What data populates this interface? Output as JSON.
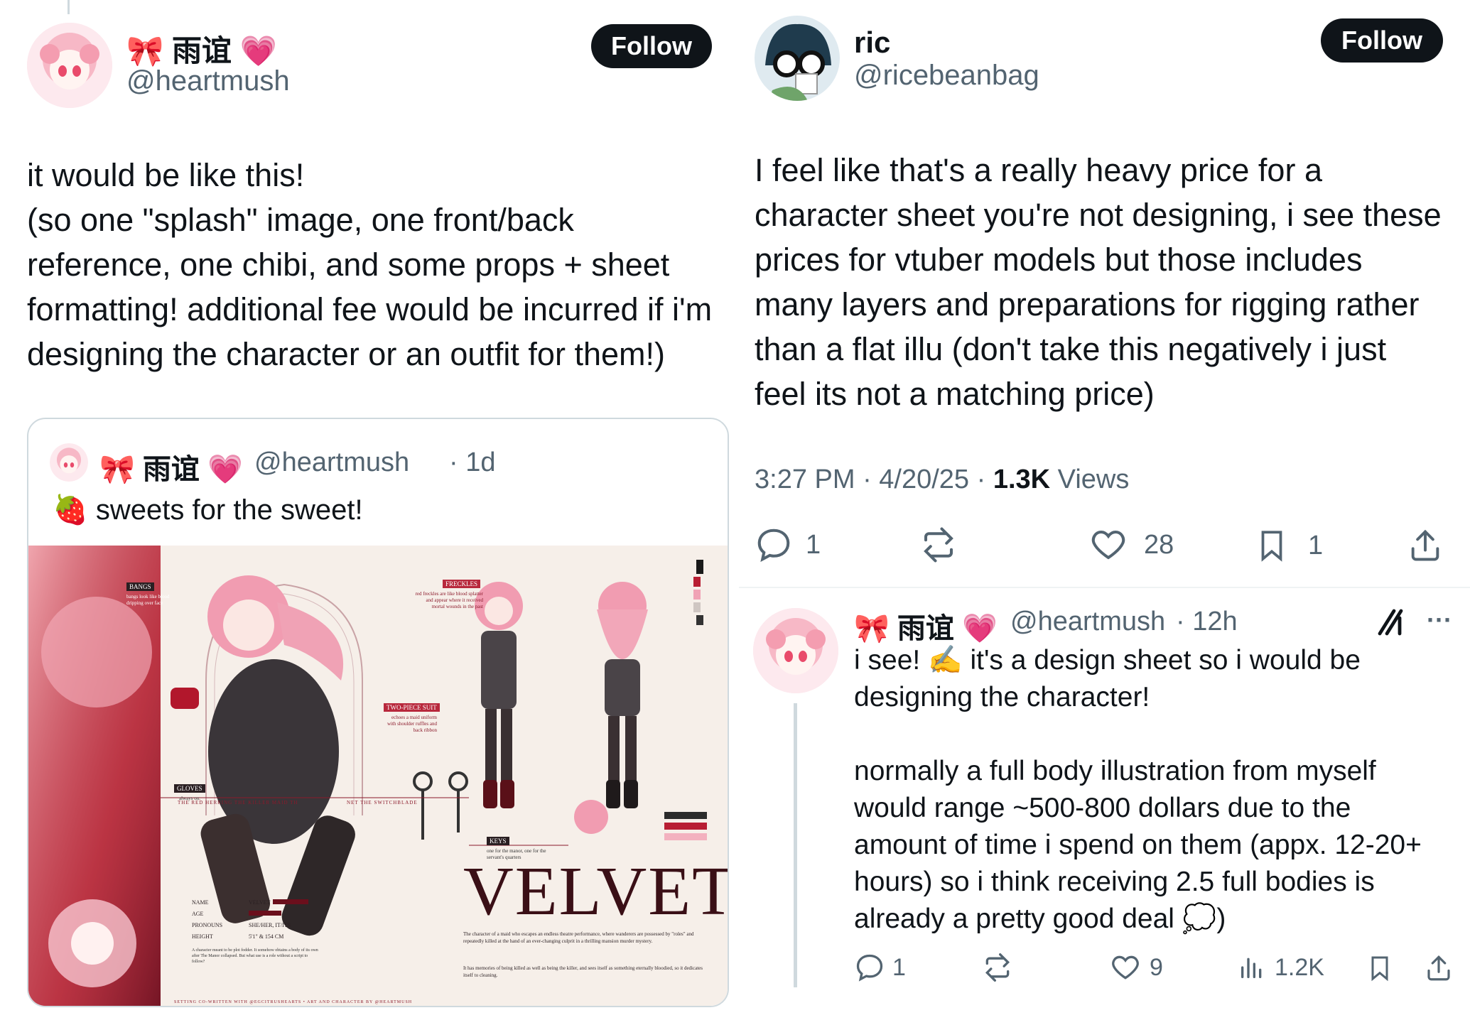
{
  "left_tweet": {
    "display_name": "🎀 雨谊 💗",
    "handle": "@heartmush",
    "follow_label": "Follow",
    "text": "it would be like this!\n(so one \"splash\" image, one front/back\nreference, one chibi, and some props + sheet\nformatting! additional fee would be incurred if i'm\ndesigning the character or an outfit for them!)",
    "quote": {
      "display_name": "🎀 雨谊 💗",
      "handle": "@heartmush",
      "time": "· 1d",
      "text": "🍓 sweets for the sweet!",
      "sheet": {
        "title": "VELVET",
        "labels": [
          "BANGS",
          "FRECKLES",
          "TWO-PIECE SUIT",
          "GLOVES",
          "KEYS"
        ],
        "notes": {
          "bangs": "bangs look like blood dripping over face",
          "freckles": "red freckles are like blood splatter and appear where it received mortal wounds in the past",
          "suit": "echoes a maid uniform with shoulder ruffles and back ribbon",
          "gloves": "always on.",
          "keys": "one for the manor, one for the servant's quarters"
        },
        "stats": [
          {
            "k": "NAME",
            "v": "VELVET"
          },
          {
            "k": "AGE",
            "v": ""
          },
          {
            "k": "PRONOUNS",
            "v": "SHE/HER, IT/ITS"
          },
          {
            "k": "HEIGHT",
            "v": "5'1\" & 154 CM"
          }
        ],
        "ribbon_left": "THE RED HERRING THE KILLER MAID TH",
        "ribbon_right": "NET THE SWITCHBLADE",
        "desc1": "The character of a maid who escapes an endless theatre performance, where wanderers are possessed by \"roles\" and repeatedly killed at the hand of an ever-changing culprit in a thrilling mansion murder mystery.",
        "desc2": "It has memories of being killed as well as being the killer, and sees itself as something eternally bloodied, so it dedicates itself to cleaning.",
        "small_note": "A character meant to be plot fodder. It somehow obtains a body of its own after The Manor collapsed. But what use is a role without a script to follow?",
        "footer": "SETTING CO-WRITTEN WITH @EGCITRUSHEARTS • ART AND CHARACTER BY @HEARTMUSH"
      }
    }
  },
  "right_tweet": {
    "display_name": "ric",
    "handle": "@ricebeanbag",
    "follow_label": "Follow",
    "text": "I feel like that's a really heavy price for a\ncharacter sheet you're not designing, i see these\nprices for vtuber models but those includes\nmany layers and preparations for rigging rather\nthan a flat illu  (don't take this negatively i just\nfeel its not a matching price)",
    "time": "3:27 PM · 4/20/25 · ",
    "views_count": "1.3K",
    "views_label": " Views",
    "stats": {
      "replies": "1",
      "reposts": "",
      "likes": "28",
      "bookmarks": "1"
    }
  },
  "reply_tweet": {
    "display_name": "🎀 雨谊 💗",
    "handle": "@heartmush",
    "time": "· 12h",
    "text": "i see! ✍️ it's a design sheet so i would be\ndesigning the character!\n\nnormally a full body illustration from myself\nwould range ~500-800 dollars due to the\namount of time i spend on them (appx. 12-20+\nhours) so i think receiving 2.5 full bodies is\nalready a pretty good deal 💭)",
    "more_label": "···",
    "stats": {
      "replies": "1",
      "reposts": "",
      "likes": "9",
      "views": "1.2K"
    }
  },
  "colors": {
    "accent": "#0f1419",
    "muted": "#536471",
    "pink": "#e0388a",
    "red": "#8b1a2b"
  }
}
